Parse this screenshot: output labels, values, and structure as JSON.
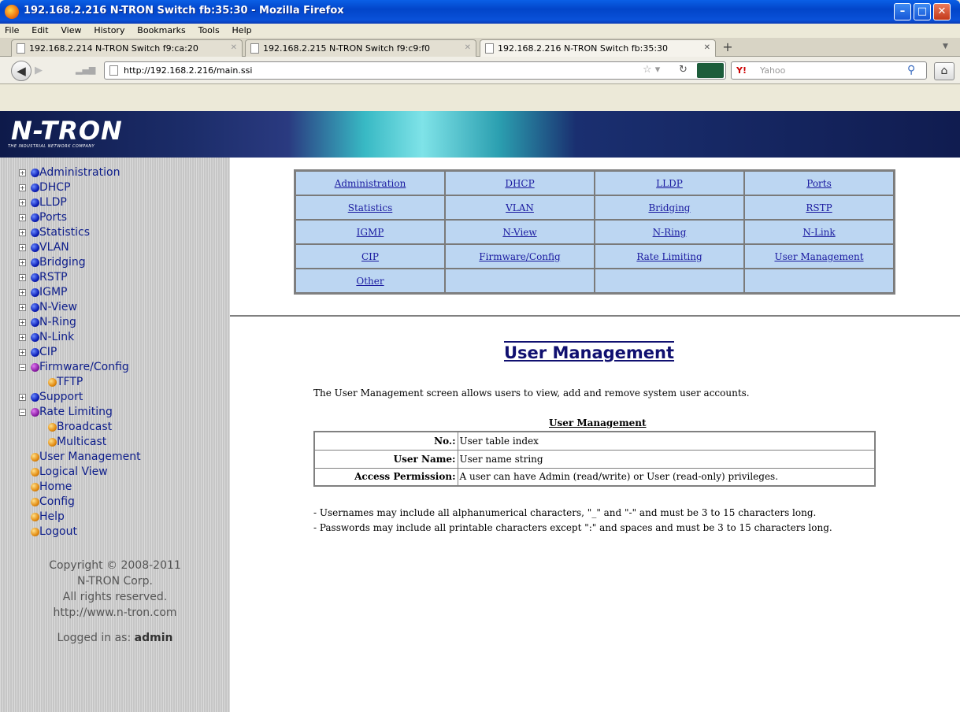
{
  "window": {
    "title": "192.168.2.216 N-TRON Switch fb:35:30 - Mozilla Firefox",
    "buttons": {
      "minimize": "–",
      "maximize": "□",
      "close": "✕"
    }
  },
  "menu": [
    "File",
    "Edit",
    "View",
    "History",
    "Bookmarks",
    "Tools",
    "Help"
  ],
  "tabs": [
    {
      "title": "192.168.2.214 N-TRON Switch f9:ca:20",
      "active": false
    },
    {
      "title": "192.168.2.215 N-TRON Switch f9:c9:f0",
      "active": false
    },
    {
      "title": "192.168.2.216 N-TRON Switch fb:35:30",
      "active": true
    }
  ],
  "tab_new_label": "+",
  "navbar": {
    "url": "http://192.168.2.216/main.ssi",
    "search_placeholder": "Yahoo",
    "search_engine_icon": "Y!"
  },
  "logo": {
    "text": "N-TRON",
    "tagline": "THE INDUSTRIAL NETWORK COMPANY"
  },
  "sidebar": {
    "items": [
      {
        "label": "Administration",
        "expander": "+",
        "color": "blue",
        "level": 0
      },
      {
        "label": "DHCP",
        "expander": "+",
        "color": "blue",
        "level": 0
      },
      {
        "label": "LLDP",
        "expander": "+",
        "color": "blue",
        "level": 0
      },
      {
        "label": "Ports",
        "expander": "+",
        "color": "blue",
        "level": 0
      },
      {
        "label": "Statistics",
        "expander": "+",
        "color": "blue",
        "level": 0
      },
      {
        "label": "VLAN",
        "expander": "+",
        "color": "blue",
        "level": 0
      },
      {
        "label": "Bridging",
        "expander": "+",
        "color": "blue",
        "level": 0
      },
      {
        "label": "RSTP",
        "expander": "+",
        "color": "blue",
        "level": 0
      },
      {
        "label": "IGMP",
        "expander": "+",
        "color": "blue",
        "level": 0
      },
      {
        "label": "N-View",
        "expander": "+",
        "color": "blue",
        "level": 0
      },
      {
        "label": "N-Ring",
        "expander": "+",
        "color": "blue",
        "level": 0
      },
      {
        "label": "N-Link",
        "expander": "+",
        "color": "blue",
        "level": 0
      },
      {
        "label": "CIP",
        "expander": "+",
        "color": "blue",
        "level": 0
      },
      {
        "label": "Firmware/Config",
        "expander": "−",
        "color": "purple",
        "level": 0
      },
      {
        "label": "TFTP",
        "expander": "",
        "color": "orange",
        "level": 1
      },
      {
        "label": "Support",
        "expander": "+",
        "color": "blue",
        "level": 0
      },
      {
        "label": "Rate Limiting",
        "expander": "−",
        "color": "purple",
        "level": 0
      },
      {
        "label": "Broadcast",
        "expander": "",
        "color": "orange",
        "level": 1
      },
      {
        "label": "Multicast",
        "expander": "",
        "color": "orange",
        "level": 1
      },
      {
        "label": "User Management",
        "expander": "",
        "color": "orange",
        "level": 0
      },
      {
        "label": "Logical View",
        "expander": "",
        "color": "orange",
        "level": 0
      },
      {
        "label": "Home",
        "expander": "",
        "color": "orange",
        "level": 0
      },
      {
        "label": "Config",
        "expander": "",
        "color": "orange",
        "level": 0
      },
      {
        "label": "Help",
        "expander": "",
        "color": "orange",
        "level": 0
      },
      {
        "label": "Logout",
        "expander": "",
        "color": "orange",
        "level": 0
      }
    ],
    "copyright": [
      "Copyright © 2008-2011",
      "N-TRON Corp.",
      "All rights reserved.",
      "http://www.n-tron.com"
    ],
    "logged_in_label": "Logged in as:",
    "logged_in_user": "admin"
  },
  "nav_table": [
    [
      "Administration",
      "DHCP",
      "LLDP",
      "Ports"
    ],
    [
      "Statistics",
      "VLAN",
      "Bridging",
      "RSTP"
    ],
    [
      "IGMP",
      "N-View",
      "N-Ring",
      "N-Link"
    ],
    [
      "CIP",
      "Firmware/Config",
      "Rate Limiting",
      "User Management"
    ],
    [
      "Other",
      "",
      "",
      ""
    ]
  ],
  "main": {
    "heading": "User Management",
    "intro": "The User Management screen allows users to view, add and remove system user accounts.",
    "table_caption": "User Management",
    "table": [
      {
        "key": "No.:",
        "value": "User table index"
      },
      {
        "key": "User Name:",
        "value": "User name string"
      },
      {
        "key": "Access Permission:",
        "value": "A user can have Admin (read/write) or User (read-only) privileges."
      }
    ],
    "notes": [
      "- Usernames may include all alphanumerical characters, \"_\" and \"-\" and must be 3 to 15 characters long.",
      "- Passwords may include all printable characters except \":\" and spaces and must be 3 to 15 characters long."
    ]
  }
}
